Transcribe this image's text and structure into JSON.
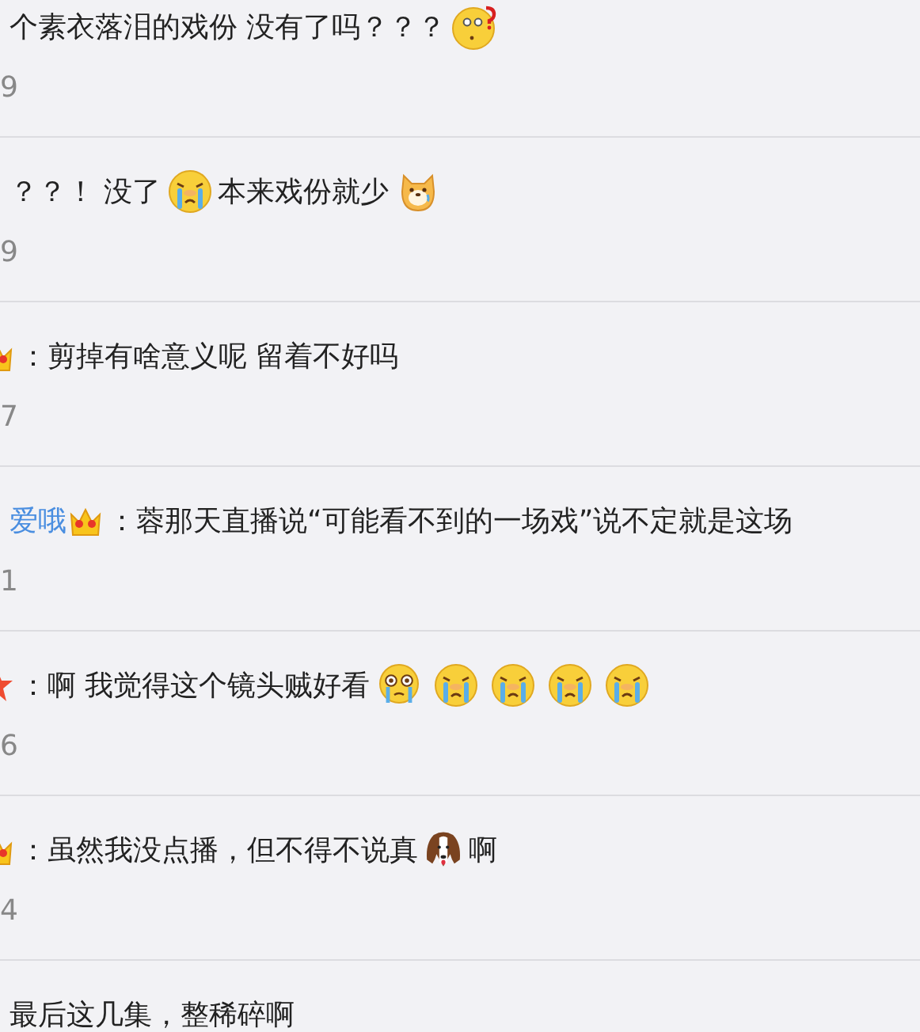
{
  "comments": [
    {
      "segments": [
        {
          "kind": "text",
          "text": "个素衣落泪的戏份 没有了吗？？？"
        },
        {
          "kind": "question-face"
        }
      ],
      "count": "9"
    },
    {
      "segments": [
        {
          "kind": "text",
          "text": "？？！ 没了"
        },
        {
          "kind": "crying-face"
        },
        {
          "kind": "text",
          "text": "本来戏份就少"
        },
        {
          "kind": "dog-emoji"
        }
      ],
      "count": "9"
    },
    {
      "segments": [
        {
          "kind": "crown-badge-cut"
        },
        {
          "kind": "text",
          "text": "：剪掉有啥意义呢 留着不好吗"
        }
      ],
      "count": "7"
    },
    {
      "segments": [
        {
          "kind": "username",
          "text": "爱哦"
        },
        {
          "kind": "crown-badge"
        },
        {
          "kind": "text",
          "text": "：蓉那天直播说“可能看不到的一场戏”说不定就是这场"
        }
      ],
      "count": "1"
    },
    {
      "segments": [
        {
          "kind": "star-badge-cut"
        },
        {
          "kind": "text",
          "text": "：啊 我觉得这个镜头贼好看"
        },
        {
          "kind": "tearful-face"
        },
        {
          "kind": "crying-face"
        },
        {
          "kind": "crying-face"
        },
        {
          "kind": "crying-face"
        },
        {
          "kind": "crying-face"
        }
      ],
      "count": "6"
    },
    {
      "segments": [
        {
          "kind": "crown-badge-cut"
        },
        {
          "kind": "text",
          "text": "：虽然我没点播，但不得不说真"
        },
        {
          "kind": "hound-emoji"
        },
        {
          "kind": "text",
          "text": "啊"
        }
      ],
      "count": "4"
    },
    {
      "segments": [
        {
          "kind": "text",
          "text": "最后这几集，整稀碎啊"
        }
      ]
    }
  ]
}
